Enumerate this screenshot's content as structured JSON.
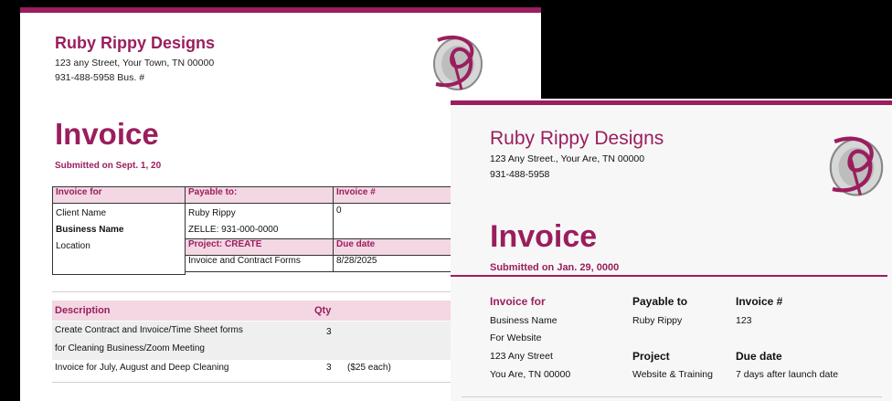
{
  "invoice1": {
    "company": "Ruby Rippy Designs",
    "address": "123 any Street, Your Town, TN 00000",
    "phone": "931-488-5958 Bus. #",
    "title": "Invoice",
    "submitted": "Submitted on Sept. 1, 20",
    "table": {
      "invoice_for_label": "Invoice for",
      "payable_to_label": "Payable to:",
      "invoice_num_label": "Invoice #",
      "client_name": "Client Name",
      "business_name": "Business Name",
      "location": "Location",
      "payable_name": "Ruby Rippy",
      "zelle": "ZELLE:  931-000-0000",
      "invoice_num": "0",
      "project_label": "Project: CREATE",
      "due_label": "Due date",
      "project_value": "Invoice and Contract Forms",
      "due_value": "8/28/2025"
    },
    "items": {
      "description_label": "Description",
      "qty_label": "Qty",
      "rows": [
        {
          "line1": "Create Contract and Invoice/Time Sheet forms",
          "line2": "for Cleaning Business/Zoom Meeting",
          "qty": "3",
          "note": ""
        },
        {
          "line1": "Invoice for July, August and Deep Cleaning",
          "line2": "",
          "qty": "3",
          "note": "($25 each)"
        }
      ]
    }
  },
  "invoice2": {
    "company": "Ruby Rippy Designs",
    "address": "123 Any Street., Your Are, TN 00000",
    "phone": "931-488-5958",
    "title": "Invoice",
    "submitted": "Submitted on Jan. 29, 0000",
    "invoice_for_label": "Invoice for",
    "invoice_for_lines": [
      "Business Name",
      "For Website",
      "123 Any Street",
      "You Are, TN 00000"
    ],
    "payable_to_label": "Payable to",
    "payable_to_value": "Ruby Rippy",
    "invoice_num_label": "Invoice #",
    "invoice_num_value": "123",
    "project_label": "Project",
    "project_value": "Website & Training",
    "due_label": "Due date",
    "due_value": "7 days after launch date"
  },
  "colors": {
    "accent": "#9a1e5e",
    "header_fill": "#f3d7e3",
    "background": "#000000"
  },
  "icons": {
    "logo": "ruby-rippy-monogram-logo"
  }
}
